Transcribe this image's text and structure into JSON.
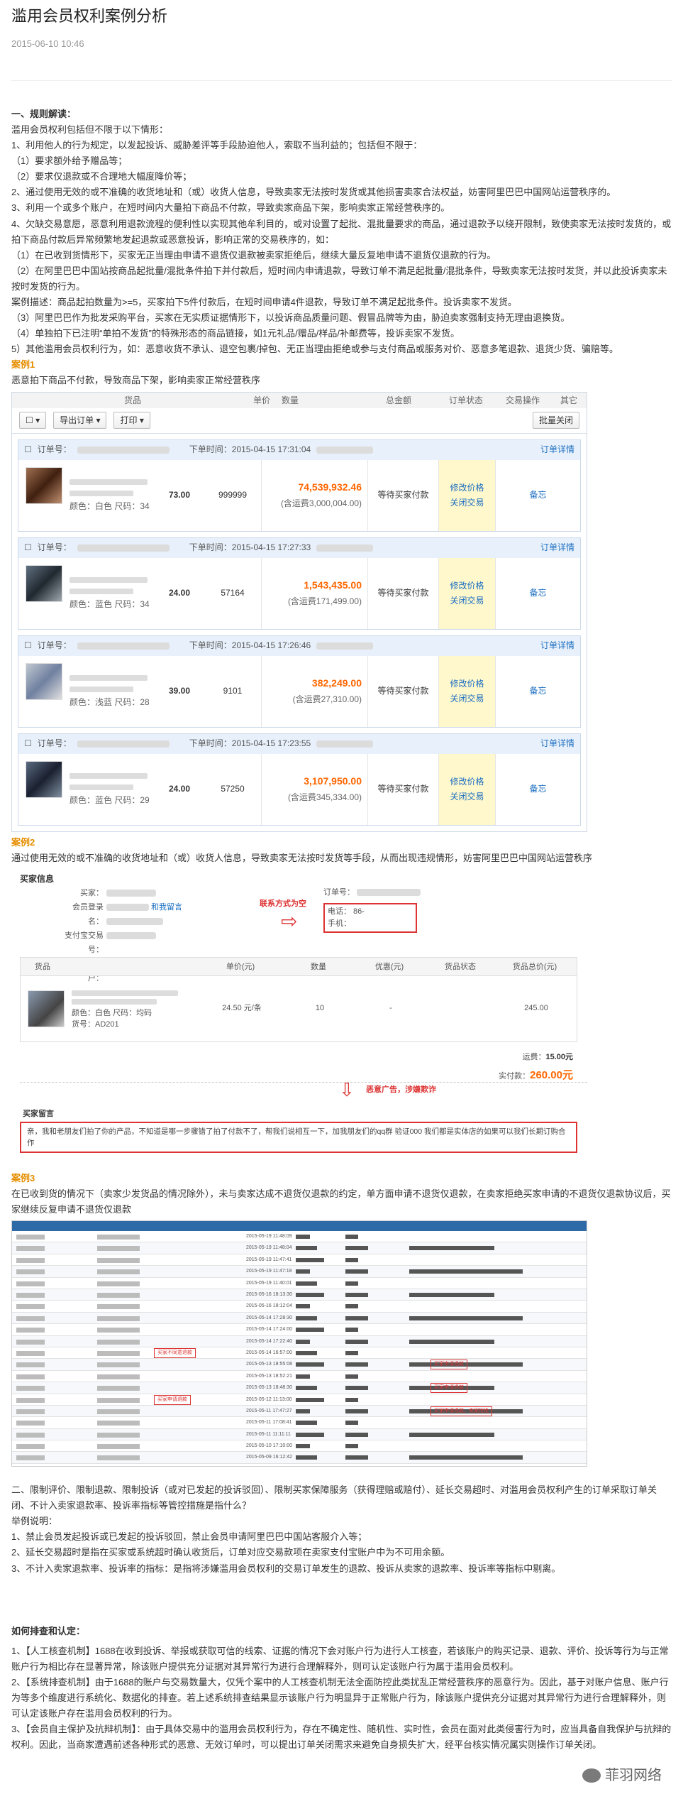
{
  "article": {
    "title": "滥用会员权利案例分析",
    "date": "2015-06-10 10:46"
  },
  "section1": {
    "heading": "一、规则解读：",
    "intro": "滥用会员权利包括但不限于以下情形：",
    "p1": "1、利用他人的行为规定，以发起投诉、威胁差评等手段胁迫他人，索取不当利益的；包括但不限于：",
    "p1a": "（1）要求额外给予赠品等；",
    "p1b": "（2）要求仅退款或不合理地大幅度降价等；",
    "p2": "2、通过使用无效的或不准确的收货地址和（或）收货人信息，导致卖家无法按时发货或其他损害卖家合法权益，妨害阿里巴巴中国网站运营秩序的。",
    "p3": "3、利用一个或多个账户，在短时间内大量拍下商品不付款，导致卖家商品下架，影响卖家正常经营秩序的。",
    "p4": "4、欠缺交易意愿，恶意利用退款流程的便利性以实现其他牟利目的，或对设置了起批、混批量要求的商品，通过退款予以绕开限制，致使卖家无法按时发货的，或拍下商品付款后异常频繁地发起退款或恶意投诉，影响正常的交易秩序的，如：",
    "p4a": "（1）在已收到货情形下，买家无正当理由申请不退货仅退款被卖家拒绝后，继续大量反复地申请不退货仅退款的行为。",
    "p4b": "（2）在阿里巴巴中国站按商品起批量/混批条件拍下并付款后，短时间内申请退款，导致订单不满足起批量/混批条件，导致卖家无法按时发货，并以此投诉卖家未按时发货的行为。",
    "p4c": "案例描述：商品起拍数量为>=5，买家拍下5件付款后，在短时间申请4件退款，导致订单不满足起批条件。投诉卖家不发货。",
    "p4d": "（3）阿里巴巴作为批发采购平台，买家在无实质证据情形下，以投诉商品质量问题、假冒品牌等为由，胁迫卖家强制支持无理由退换货。",
    "p4e": "（4）单独拍下已注明“单拍不发货”的特殊形态的商品链接，如1元礼品/赠品/样品/补邮费等，投诉卖家不发货。",
    "p5": "5）其他滥用会员权利行为，如：恶意收货不承认、退空包裹/掉包、无正当理由拒绝或参与支付商品或服务对价、恶意多笔退款、退货少货、骗赔等。"
  },
  "case1": {
    "label": "案例1",
    "desc": "恶意拍下商品不付款，导致商品下架，影响卖家正常经营秩序",
    "table": {
      "col_goods": "货品",
      "col_price": "单价",
      "col_qty": "数量",
      "col_total": "总金额",
      "col_status": "订单状态",
      "col_action": "交易操作",
      "col_other": "其它",
      "export_btn": "导出订单 ▾",
      "print_btn": "打印 ▾",
      "batch_btn": "批量关闭",
      "order_no_label": "订单号：",
      "detail_link": "订单详情",
      "status": "等待买家付款",
      "modify_price": "修改价格",
      "close_trade": "关闭交易",
      "memo": "备忘",
      "orders": [
        {
          "time": "下单时间：2015-04-15 17:31:04",
          "price": "73.00",
          "qty": "999999",
          "total": "74,539,932.46",
          "ship": "(含运费3,000,004.00)",
          "attr": "颜色：白色    尺码：34"
        },
        {
          "time": "下单时间：2015-04-15 17:27:33",
          "price": "24.00",
          "qty": "57164",
          "total": "1,543,435.00",
          "ship": "(含运费171,499.00)",
          "attr": "颜色：蓝色    尺码：34"
        },
        {
          "time": "下单时间：2015-04-15 17:26:46",
          "price": "39.00",
          "qty": "9101",
          "total": "382,249.00",
          "ship": "(含运费27,310.00)",
          "attr": "颜色：浅蓝    尺码：28"
        },
        {
          "time": "下单时间：2015-04-15 17:23:55",
          "price": "24.00",
          "qty": "57250",
          "total": "3,107,950.00",
          "ship": "(含运费345,334.00)",
          "attr": "颜色：蓝色    尺码：29"
        }
      ]
    }
  },
  "case2": {
    "label": "案例2",
    "desc": "通过使用无效的或不准确的收货地址和（或）收货人信息，导致卖家无法按时发货等手段，从而出现违规情形，妨害阿里巴巴中国网站运营秩序",
    "buyer_info": "买家信息",
    "buyer": "买家：",
    "member": "会员登录名：",
    "member_link": "和我留言",
    "alipay_acct": "支付宝交易号：",
    "alipay_user": "支付宝账户：",
    "order_no": "订单号：",
    "phone": "电话：  86-",
    "mobile": "手机：",
    "annot1": "联系方式为空",
    "col_goods": "货品",
    "col_price": "单价(元)",
    "col_qty": "数量",
    "col_discount": "优惠(元)",
    "col_status": "货品状态",
    "col_amount": "货品总价(元)",
    "attr": "颜色：白色    尺码：均码",
    "sku": "货号：AD201",
    "price": "24.50 元/条",
    "qty": "10",
    "discount": "-",
    "amount": "245.00",
    "freight_label": "运费：",
    "freight": "15.00元",
    "paid_label": "实付款：",
    "paid": "260.00元",
    "annot2": "恶意广告，涉嫌欺诈",
    "msg_title": "买家留言",
    "msg": "亲，我和老朋友们拍了你的产品，不知道是哪一步骤错了拍了付款不了，帮我们说相互一下，加我朋友们的qq群               验证000  我们都是实体店的如果可以我们长期订购合作"
  },
  "case3": {
    "label": "案例3",
    "desc": "在已收到货的情况下（卖家少发货品的情况除外），未与卖家达成不退货仅退款的约定，单方面申请不退货仅退款，在卖家拒绝买家申请的不退货仅退款协议后，买家继续反复申请不退货仅退款",
    "annots": [
      "买家不同意退款",
      "买家不同意退款",
      "买家申请退款",
      "买家申请退款",
      "买家申请退款，卖家拒绝"
    ],
    "dates": [
      "2015-05-19 11:48:09",
      "2015-05-19 11:48:04",
      "2015-05-19 11:47:41",
      "2015-05-19 11:47:18",
      "2015-05-19 11:40:01",
      "2015-05-16 18:13:30",
      "2015-05-16 18:12:04",
      "2015-05-14 17:28:30",
      "2015-05-14 17:24:00",
      "2015-05-14 17:22:40",
      "2015-05-14 16:57:00",
      "2015-05-13 18:55:08",
      "2015-05-13 18:52:21",
      "2015-05-13 18:48:30",
      "2015-05-12 11:13:00",
      "2015-05-11 17:47:27",
      "2015-05-11 17:08:41",
      "2015-05-11 11:11:11",
      "2015-05-10 17:10:00",
      "2015-05-09 16:12:42"
    ]
  },
  "section2": {
    "heading": "二、限制评价、限制退款、限制投诉（或对已发起的投诉驳回）、限制买家保障服务（获得理赔或赔付）、延长交易超时、对滥用会员权利产生的订单采取订单关闭、不计入卖家退款率、投诉率指标等管控措施是指什么？",
    "sub": "举例说明：",
    "p1": "1、禁止会员发起投诉或已发起的投诉驳回，禁止会员申请阿里巴巴中国站客服介入等；",
    "p2": "2、延长交易超时是指在买家或系统超时确认收货后，订单对应交易款项在卖家支付宝账户中为不可用余额。",
    "p3": "3、不计入卖家退款率、投诉率的指标：是指将涉嫌滥用会员权利的交易订单发生的退款、投诉从卖家的退款率、投诉率等指标中剔离。"
  },
  "section3": {
    "heading": "如何排查和认定：",
    "p1": "1、【人工核查机制】1688在收到投诉、举报或获取可信的线索、证据的情况下会对账户行为进行人工核查，若该账户的购买记录、退款、评价、投诉等行为与正常账户行为相比存在显著异常，除该账户提供充分证据对其异常行为进行合理解释外，则可认定该账户行为属于滥用会员权利。",
    "p2": "2、【系统排查机制】由于1688的账户与交易数量大，仅凭个案中的人工核查机制无法全面防控此类扰乱正常经营秩序的恶意行为。因此，基于对账户信息、账户行为等多个维度进行系统化、数据化的排查。若上述系统排查结果显示该账户行为明显异于正常账户行为，除该账户提供充分证据对其异常行为进行合理解释外，则可认定该账户存在滥用会员权利的行为。",
    "p3": "3、【会员自主保护及抗辩机制】：由于具体交易中的滥用会员权利行为，存在不确定性、随机性、实时性，会员在面对此类侵害行为时，应当具备自我保护与抗辩的权利。因此，当商家遭遇前述各种形式的恶意、无效订单时，可以提出订单关闭需求来避免自身损失扩大，经平台核实情况属实则操作订单关闭。"
  },
  "watermark": {
    "text": "菲羽网络"
  },
  "colors": {
    "case_label": "#e58e00",
    "price": "#ff6600",
    "link": "#1d6fc2",
    "annot_red": "#d33333"
  }
}
